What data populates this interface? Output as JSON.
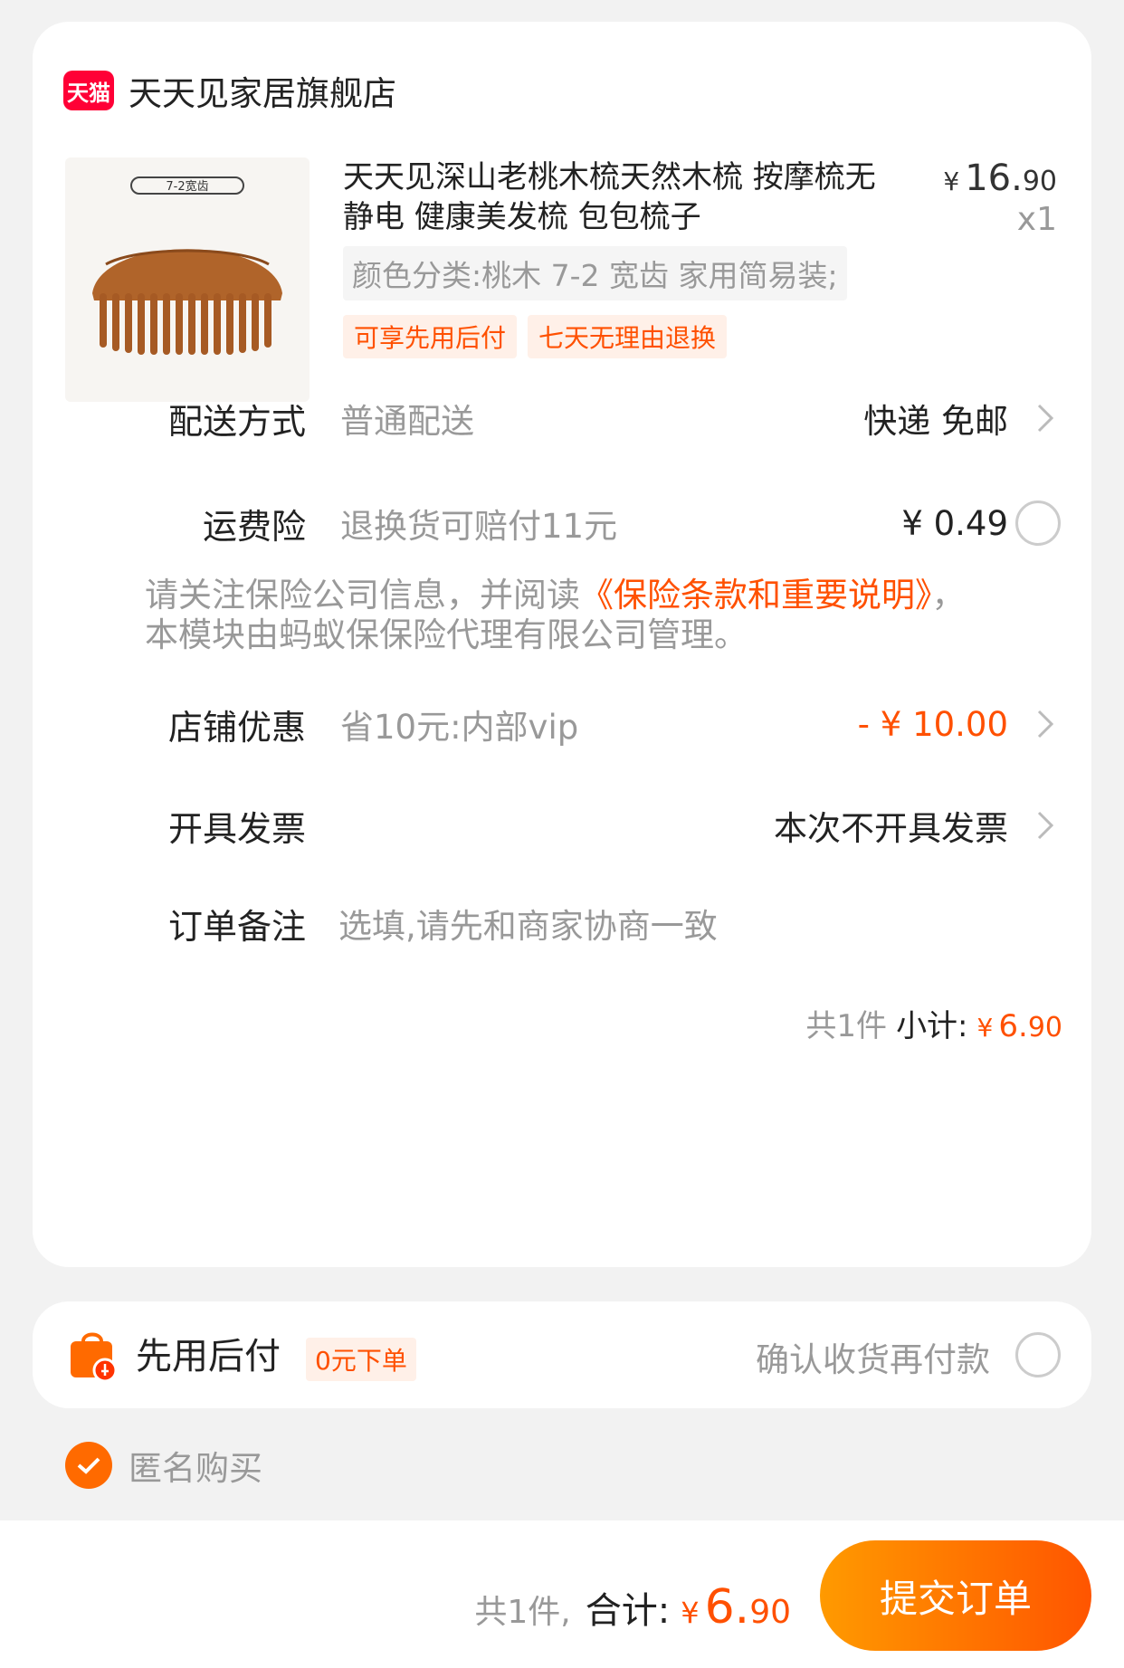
{
  "store": {
    "badge": "天猫",
    "name": "天天见家居旗舰店"
  },
  "product": {
    "image_label": "7-2宽齿",
    "title": "天天见深山老桃木梳天然木梳 按摩梳无静电 健康美发梳 包包梳子",
    "price_symbol": "¥",
    "price_int": "16.",
    "price_dec": "90",
    "qty": "x1",
    "sku": "颜色分类:桃木 7-2 宽齿  家用简易装;",
    "tags": [
      "可享先用后付",
      "七天无理由退换"
    ]
  },
  "delivery": {
    "label": "配送方式",
    "value": "普通配送",
    "right": "快递 免邮"
  },
  "insurance": {
    "label": "运费险",
    "value": "退换货可赔付11元",
    "right": "¥ 0.49",
    "notice_prefix": "请关注保险公司信息，并阅读",
    "notice_link": "《保险条款和重要说明》",
    "notice_suffix": "，本模块由蚂蚁保保险代理有限公司管理。"
  },
  "discount": {
    "label": "店铺优惠",
    "value": "省10元:内部vip",
    "right": "- ¥ 10.00"
  },
  "invoice": {
    "label": "开具发票",
    "right": "本次不开具发票"
  },
  "remark": {
    "label": "订单备注",
    "placeholder": "选填,请先和商家协商一致"
  },
  "subtotal": {
    "count": "共1件",
    "label": "小计:",
    "symbol": "¥",
    "int": "6.",
    "dec": "90"
  },
  "pay_later": {
    "title": "先用后付",
    "tag": "0元下单",
    "desc": "确认收货再付款"
  },
  "anonymous": {
    "label": "匿名购买",
    "checked": true
  },
  "footer": {
    "count": "共1件,",
    "label": "合计:",
    "symbol": "¥",
    "int": "6.",
    "dec": "90",
    "submit": "提交订单"
  },
  "colors": {
    "accent": "#ff5000",
    "tmall": "#ff0036",
    "muted": "#999999"
  }
}
